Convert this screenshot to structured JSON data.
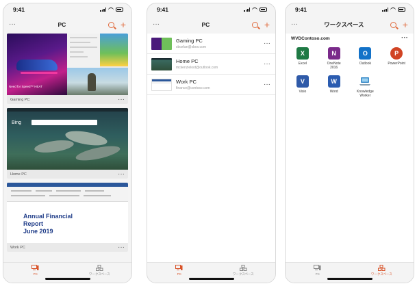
{
  "status": {
    "time": "9:41"
  },
  "phone1": {
    "title": "PC",
    "more": "···",
    "cards": [
      {
        "label": "Gaming PC",
        "game_title": "Need for Speed™ HEAT"
      },
      {
        "label": "Home PC",
        "brand": "Bing"
      },
      {
        "label": "Work PC",
        "doc_heading_1": "Annual Financial",
        "doc_heading_2": "Report",
        "doc_heading_3": "June 2019"
      }
    ]
  },
  "phone2": {
    "title": "PC",
    "rows": [
      {
        "name": "Gaming PC",
        "email": "xboxfan@xbox.com"
      },
      {
        "name": "Home PC",
        "email": "mckenzieloot@outlook.com"
      },
      {
        "name": "Work PC",
        "email": "finance@contoso.com"
      }
    ]
  },
  "phone3": {
    "title": "ワークスペース",
    "workspace": "WVDContoso.com",
    "apps": [
      {
        "name": "Excel",
        "letter": "X",
        "color": "#1f7a45"
      },
      {
        "name": "OneNote 2016",
        "letter": "N",
        "color": "#7a2a8a"
      },
      {
        "name": "Outlook",
        "letter": "O",
        "color": "#1372c8"
      },
      {
        "name": "PowerPoint",
        "letter": "P",
        "color": "#d14424"
      },
      {
        "name": "Visio",
        "letter": "V",
        "color": "#2f5aa8"
      },
      {
        "name": "Word",
        "letter": "W",
        "color": "#2b5cb0"
      },
      {
        "name": "Knowledge Worker",
        "letter": "",
        "color": "#3b8bc8"
      }
    ]
  },
  "tabs": {
    "pc": "PC",
    "workspace": "ワークスペース"
  },
  "colors": {
    "accent": "#e06a3c"
  }
}
